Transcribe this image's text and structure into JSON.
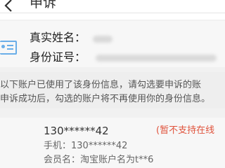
{
  "header": {
    "title": "申诉",
    "back_icon": "chevron-left-icon"
  },
  "identity": {
    "icon": "id-card-icon",
    "accent_color": "#6aaee8",
    "name_label": "真实姓名：",
    "id_label": "身份证号："
  },
  "notice": {
    "line1": "以下账户已使用了该身份信息，请勾选要申诉的账",
    "line2": "申诉成功后，勾选的账户将不再使用你的身份信息。"
  },
  "accounts": [
    {
      "number": "130******42",
      "status": "(暂不支持在线",
      "status_color": "#e0533c",
      "phone": "手机：130******42",
      "member": "会员名：淘宝账户名为t**6"
    }
  ]
}
